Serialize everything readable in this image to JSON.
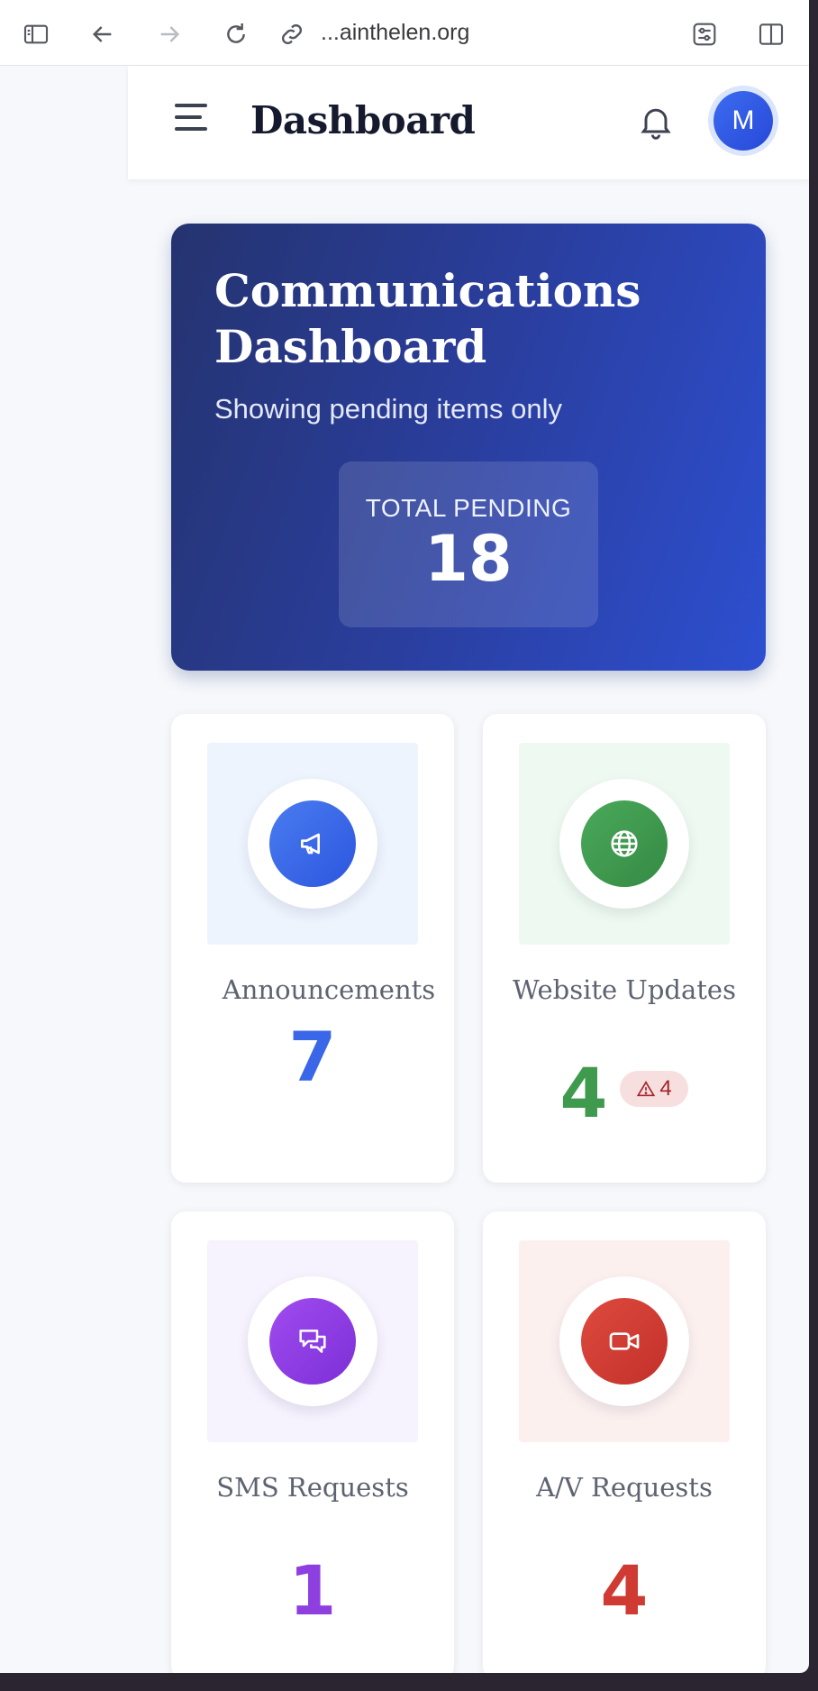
{
  "browser": {
    "url": "...ainthelen.org",
    "icons": [
      "sidebar-icon",
      "back-arrow-icon",
      "forward-arrow-icon",
      "reload-icon",
      "link-icon",
      "settings-sliders-icon",
      "split-view-icon"
    ]
  },
  "header": {
    "title": "Dashboard",
    "avatar_initial": "M"
  },
  "hero": {
    "title": "Communications Dashboard",
    "subtitle": "Showing pending items only",
    "pending_label": "TOTAL PENDING",
    "pending_value": "18"
  },
  "cards": [
    {
      "label": "Announcements",
      "count": "7",
      "icon": "megaphone-icon",
      "color": "#3a66e8",
      "tile": "#eef4fe"
    },
    {
      "label": "Website Updates",
      "count": "4",
      "icon": "globe-icon",
      "color": "#3f9a4e",
      "tile": "#eefaf1",
      "warning": "4"
    },
    {
      "label": "SMS Requests",
      "count": "1",
      "icon": "chat-bubbles-icon",
      "color": "#8e3fe0",
      "tile": "#f6f2fe"
    },
    {
      "label": "A/V Requests",
      "count": "4",
      "icon": "video-camera-icon",
      "color": "#cf3a32",
      "tile": "#fcf0ef"
    }
  ]
}
